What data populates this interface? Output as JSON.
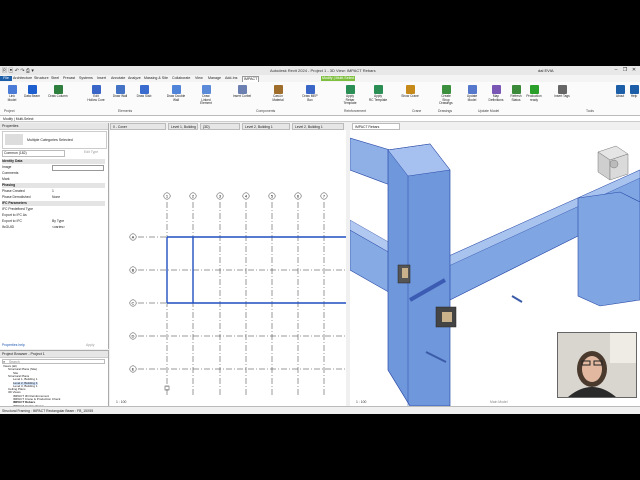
{
  "window": {
    "title": "Autodesk Revit 2024 - Project 1 - 3D View: IMPACT Rebars",
    "user": "dal EVIA",
    "minimize": "–",
    "maximize": "❐",
    "close": "✕"
  },
  "tabs": {
    "file": "File",
    "items": [
      "Architecture",
      "Structure",
      "Steel",
      "Precast",
      "Systems",
      "Insert",
      "Annotate",
      "Analyze",
      "Massing & Site",
      "Collaborate",
      "View",
      "Manage",
      "Add-Ins",
      "IMPACT"
    ],
    "contextual": "Modify | Multi-Select"
  },
  "ribbon": {
    "buttons": [
      {
        "label": "Link\nModel"
      },
      {
        "label": "Data Beam"
      },
      {
        "label": "Draw Column"
      },
      {
        "label": "Edit\nHollow Core"
      },
      {
        "label": "Draw Wall"
      },
      {
        "label": "Draw Slab"
      },
      {
        "label": "Draw Double Wall"
      },
      {
        "label": "Draw\nLinked Element"
      },
      {
        "label": "Insert Corbel"
      },
      {
        "label": "Cast-in Material"
      },
      {
        "label": "Draw MEP Box"
      },
      {
        "label": "Apply\nRebar Template"
      },
      {
        "label": "Apply\nRC Template"
      },
      {
        "label": "Show Crane"
      },
      {
        "label": "Create\nShop Drawings"
      },
      {
        "label": "Update\nModel"
      },
      {
        "label": "Map\nDefinitions"
      },
      {
        "label": "Refresh\nStatus"
      },
      {
        "label": "Production\nready"
      },
      {
        "label": "Insert Tags"
      },
      {
        "label": "About"
      },
      {
        "label": "Help"
      }
    ],
    "panels": [
      "Project",
      "Elements",
      "Components",
      "Reinforcement",
      "Crane",
      "Drawings",
      "Update Model",
      "Tools"
    ]
  },
  "modebar": "Modify | Multi-Select",
  "properties": {
    "header": "Properties",
    "type": "Multiple Categories Selected",
    "selector": "Common (182)",
    "edit_type": "Edit Type",
    "rows": [
      {
        "k": "Identity Data",
        "v": "",
        "group": true
      },
      {
        "k": "Image",
        "v": "",
        "field": true
      },
      {
        "k": "Comments",
        "v": ""
      },
      {
        "k": "Mark",
        "v": ""
      },
      {
        "k": "Phasing",
        "v": "",
        "group": true
      },
      {
        "k": "Phase Created",
        "v": "1"
      },
      {
        "k": "Phase Demolished",
        "v": "None"
      },
      {
        "k": "IFC Parameters",
        "v": "",
        "group": true
      },
      {
        "k": "IFC Predefined Type",
        "v": ""
      },
      {
        "k": "Export to IFC As",
        "v": ""
      },
      {
        "k": "Export to IFC",
        "v": "By Type"
      },
      {
        "k": "IfcGUID",
        "v": "<varies>"
      }
    ],
    "help": "Properties help",
    "apply": "Apply"
  },
  "browser": {
    "header": "Project Browser - Project 1",
    "search_placeholder": "Search",
    "items": [
      {
        "label": "Views (all)",
        "indent": 0
      },
      {
        "label": "Structural Plans (Site)",
        "indent": 1
      },
      {
        "label": "Site",
        "indent": 2
      },
      {
        "label": "Structural Plans",
        "indent": 1
      },
      {
        "label": "Level 1, Building 1",
        "indent": 2
      },
      {
        "label": "Level 2, Building 1",
        "indent": 2,
        "sel": true
      },
      {
        "label": "Level 3, Building 1",
        "indent": 2
      },
      {
        "label": "Ceiling Plans",
        "indent": 1
      },
      {
        "label": "3D Views",
        "indent": 1
      },
      {
        "label": "IMPACT 3D Reinforcement",
        "indent": 2
      },
      {
        "label": "IMPACT Crane & Production Check",
        "indent": 2
      },
      {
        "label": "IMPACT Rebars",
        "indent": 2,
        "bold": true
      },
      {
        "label": "IMPACT Update Status",
        "indent": 2
      },
      {
        "label": "{3D}",
        "indent": 2
      },
      {
        "label": "Elevations (Building Elevation)",
        "indent": 1
      }
    ]
  },
  "view_tabs": [
    {
      "label": "0 - Cover"
    },
    {
      "label": "Level 1, Building 1"
    },
    {
      "label": "{3D}"
    },
    {
      "label": "Level 2, Building 1"
    },
    {
      "label": "Level 2, Building 1"
    },
    {
      "label": "IMPACT Rebars",
      "active": true
    }
  ],
  "plan": {
    "grid_cols": [
      "1",
      "2",
      "3",
      "4",
      "5",
      "6",
      "7"
    ],
    "grid_rows": [
      "A",
      "B",
      "C",
      "D",
      "E"
    ],
    "scale": "1 : 100"
  },
  "view3d": {
    "scale": "1 : 100",
    "main_model": "Main Model"
  },
  "status": "Structural Framing : IMPACT Rectangular Beam : FB_15X55",
  "colors": {
    "accent": "#1d5ea8",
    "contextual": "#7fbf3f",
    "concrete": "#7fa8e0",
    "beam_blue": "#1f4fbf"
  }
}
